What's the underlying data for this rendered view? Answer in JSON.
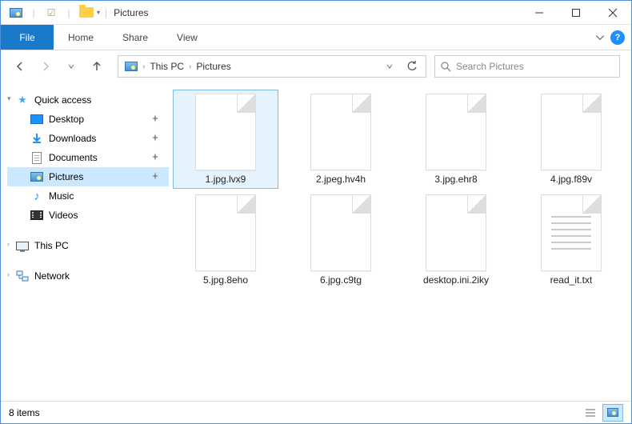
{
  "window": {
    "title": "Pictures"
  },
  "ribbon": {
    "file": "File",
    "tabs": [
      "Home",
      "Share",
      "View"
    ]
  },
  "address": {
    "crumbs": [
      "This PC",
      "Pictures"
    ]
  },
  "search": {
    "placeholder": "Search Pictures"
  },
  "nav": {
    "quick_access": "Quick access",
    "items": [
      {
        "label": "Desktop",
        "pinned": true
      },
      {
        "label": "Downloads",
        "pinned": true
      },
      {
        "label": "Documents",
        "pinned": true
      },
      {
        "label": "Pictures",
        "pinned": true,
        "selected": true
      },
      {
        "label": "Music",
        "pinned": false
      },
      {
        "label": "Videos",
        "pinned": false
      }
    ],
    "this_pc": "This PC",
    "network": "Network"
  },
  "files": [
    {
      "name": "1.jpg.lvx9",
      "kind": "blank",
      "selected": true
    },
    {
      "name": "2.jpeg.hv4h",
      "kind": "blank"
    },
    {
      "name": "3.jpg.ehr8",
      "kind": "blank"
    },
    {
      "name": "4.jpg.f89v",
      "kind": "blank"
    },
    {
      "name": "5.jpg.8eho",
      "kind": "blank"
    },
    {
      "name": "6.jpg.c9tg",
      "kind": "blank"
    },
    {
      "name": "desktop.ini.2iky",
      "kind": "blank"
    },
    {
      "name": "read_it.txt",
      "kind": "txt"
    }
  ],
  "status": {
    "count_label": "8 items"
  }
}
